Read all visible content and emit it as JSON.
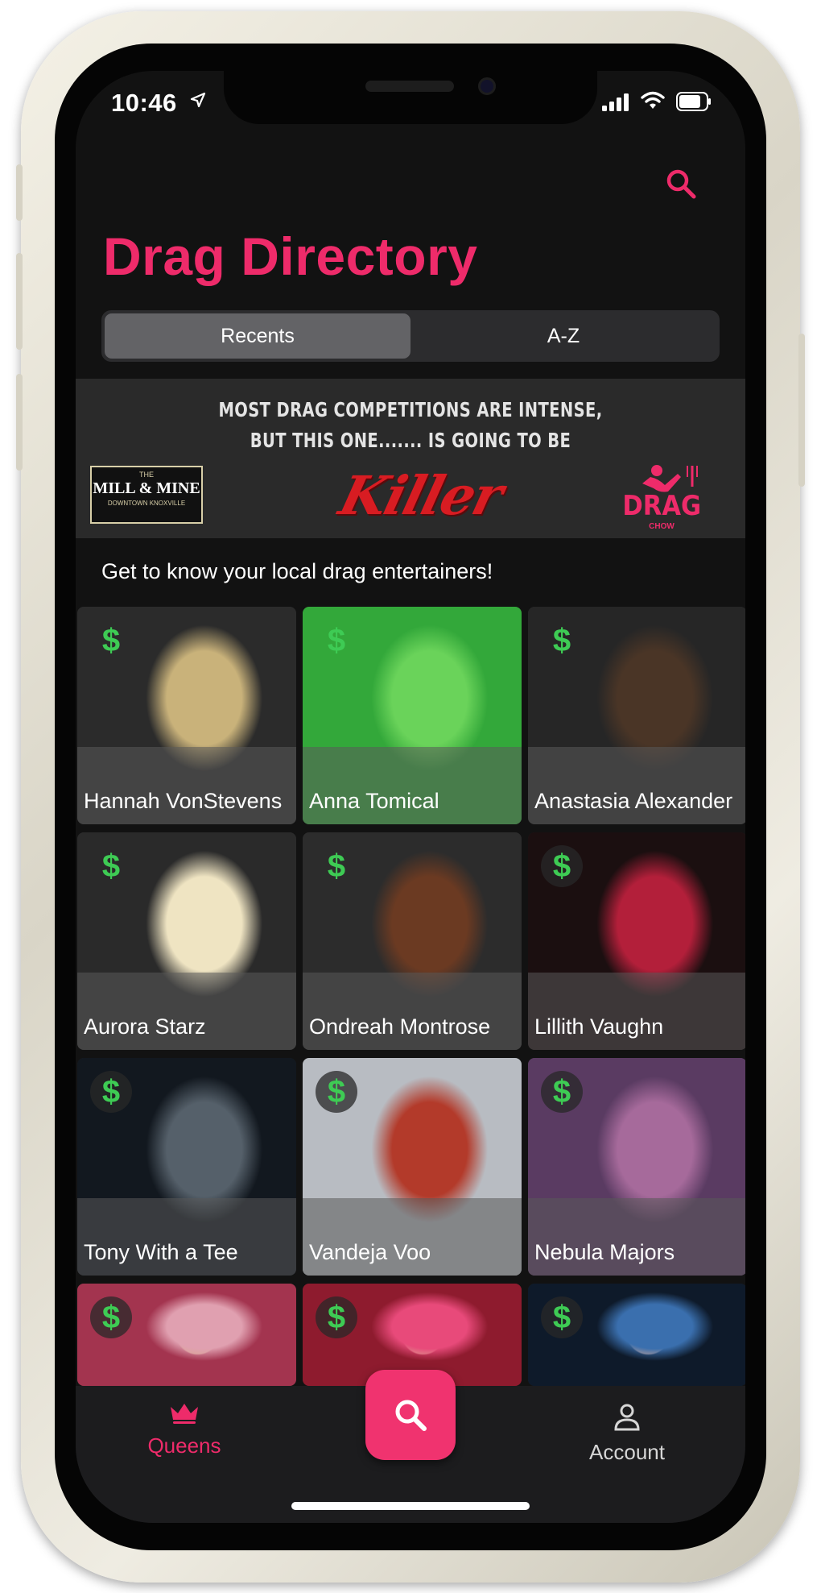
{
  "status_bar": {
    "time": "10:46"
  },
  "header": {
    "title": "Drag Directory"
  },
  "segments": [
    {
      "label": "Recents",
      "active": true
    },
    {
      "label": "A-Z",
      "active": false
    }
  ],
  "banner": {
    "line1": "MOST DRAG COMPETITIONS ARE INTENSE,",
    "line2": "BUT THIS ONE....... IS GOING TO BE",
    "left_logo": {
      "top": "THE",
      "main": "MILL & MINE",
      "sub": "DOWNTOWN KNOXVILLE"
    },
    "center_logo": "Killer",
    "right_logo": {
      "main": "DRAG",
      "sub": "CHOW"
    }
  },
  "intro": "Get to know your local drag entertainers!",
  "performers": [
    {
      "name": "Hannah VonStevens",
      "bg": "#2b2b2b",
      "accent": "#c9b27a"
    },
    {
      "name": "Anna Tomical",
      "bg": "#33a83a",
      "accent": "#6ad35a"
    },
    {
      "name": "Anastasia Alexander",
      "bg": "#262626",
      "accent": "#4a3526"
    },
    {
      "name": "Aurora Starz",
      "bg": "#2a2a2a",
      "accent": "#efe4c2"
    },
    {
      "name": "Ondreah Montrose",
      "bg": "#2c2c2c",
      "accent": "#6b3a22"
    },
    {
      "name": "Lillith Vaughn",
      "bg": "#1b0f10",
      "accent": "#b31f3a"
    },
    {
      "name": "Tony With a Tee",
      "bg": "#12181f",
      "accent": "#55606a"
    },
    {
      "name": "Vandeja Voo",
      "bg": "#b8bcc2",
      "accent": "#b33a2a"
    },
    {
      "name": "Nebula Majors",
      "bg": "#5a3b62",
      "accent": "#a66a9b"
    },
    {
      "name": "",
      "bg": "#a3344f",
      "accent": "#e0a0b0"
    },
    {
      "name": "",
      "bg": "#8e1b2e",
      "accent": "#e84a7a"
    },
    {
      "name": "",
      "bg": "#0e1a2a",
      "accent": "#3a6fae"
    }
  ],
  "currency_symbol": "$",
  "nav": {
    "queens": "Queens",
    "account": "Account"
  },
  "colors": {
    "accent": "#ee2b6a",
    "dollar": "#3ecb54",
    "background": "#121212"
  },
  "icons": [
    "location-arrow-icon",
    "signal-icon",
    "wifi-icon",
    "battery-icon",
    "search-icon",
    "dollar-icon",
    "crown-icon",
    "person-icon"
  ]
}
